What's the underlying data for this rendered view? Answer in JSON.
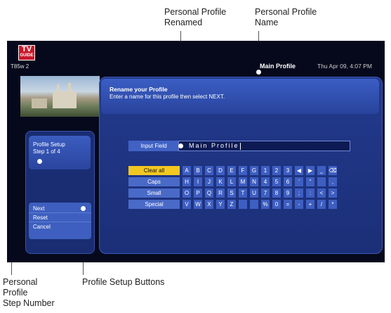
{
  "callouts": {
    "renamed": "Personal Profile\nRenamed",
    "name": "Personal Profile\nName",
    "step_number": "Personal\nProfile\nStep Number",
    "buttons": "Profile Setup Buttons"
  },
  "screen": {
    "logo_top": "TV",
    "logo_bottom": "GUIDE",
    "channel": "T85w 2",
    "profile_name": "Main Profile",
    "datetime": "Thu Apr 09, 4:07 PM",
    "header_title": "Rename your Profile",
    "header_subtitle": "Enter a name for this profile then select NEXT.",
    "setup_title": "Profile Setup",
    "setup_step": "Step 1 of 4",
    "buttons": [
      "Next",
      "Reset",
      "Cancel"
    ],
    "input_label": "Input Field",
    "input_value": "Main Profile",
    "modes": [
      "Clear all",
      "Caps",
      "Small",
      "Special"
    ],
    "active_mode": "Clear all",
    "keyboard_rows": [
      [
        "A",
        "B",
        "C",
        "D",
        "E",
        "F",
        "G",
        "1",
        "2",
        "3",
        "◀",
        "▶",
        "⎵",
        "⌫"
      ],
      [
        "H",
        "I",
        "J",
        "K",
        "L",
        "M",
        "N",
        "4",
        "5",
        "6",
        "'",
        "\"",
        "",
        ","
      ],
      [
        "O",
        "P",
        "Q",
        "R",
        "S",
        "T",
        "U",
        "7",
        "8",
        "9",
        ";",
        ":",
        "<",
        ">"
      ],
      [
        "V",
        "W",
        "X",
        "Y",
        "Z",
        "",
        "",
        "%",
        "0",
        "=",
        "-",
        "+",
        "/",
        "*"
      ]
    ]
  }
}
